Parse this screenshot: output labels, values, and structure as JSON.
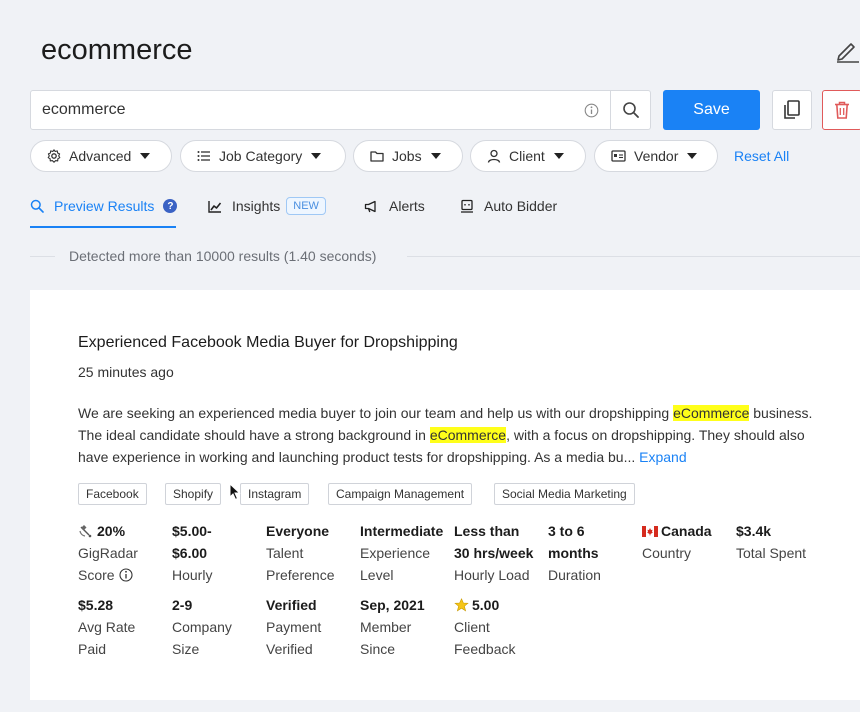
{
  "header": {
    "title": "ecommerce"
  },
  "search": {
    "value": "ecommerce",
    "save_label": "Save"
  },
  "filters": [
    {
      "label": "Advanced",
      "icon": "gear-icon"
    },
    {
      "label": "Job Category",
      "icon": "list-icon"
    },
    {
      "label": "Jobs",
      "icon": "folder-icon"
    },
    {
      "label": "Client",
      "icon": "user-icon"
    },
    {
      "label": "Vendor",
      "icon": "id-card-icon"
    }
  ],
  "reset_label": "Reset All",
  "tabs": [
    {
      "label": "Preview Results",
      "icon": "search-icon",
      "active": true
    },
    {
      "label": "Insights",
      "badge": "NEW",
      "icon": "chart-icon"
    },
    {
      "label": "Alerts",
      "icon": "megaphone-icon"
    },
    {
      "label": "Auto Bidder",
      "icon": "bot-icon"
    }
  ],
  "results_info": "Detected more than 10000 results (1.40 seconds)",
  "job": {
    "title": "Experienced Facebook Media Buyer for Dropshipping",
    "posted": "25 minutes ago",
    "desc_1": "We are seeking an experienced media buyer to join our team and help us with our dropshipping ",
    "highlight_1": "eCommerce",
    "desc_2": " business. The ideal candidate should have a strong background in ",
    "highlight_2": "eCommerce",
    "desc_3": ", with a focus on dropshipping. They should also have experience in working and launching product tests for dropshipping. As a media bu...",
    "expand_label": " Expand",
    "tags": [
      "Facebook",
      "Shopify",
      "Instagram",
      "Campaign Management",
      "Social Media Marketing"
    ],
    "stats_row1": [
      {
        "value": "20%",
        "icon": "radar-icon",
        "lines": [
          "GigRadar",
          "Score"
        ]
      },
      {
        "value": "$5.00-",
        "value2": "$6.00",
        "lines": [
          "Hourly"
        ]
      },
      {
        "value": "Everyone",
        "lines": [
          "Talent",
          "Preference"
        ]
      },
      {
        "value": "Intermediate",
        "lines": [
          "Experience",
          "Level"
        ]
      },
      {
        "value": "Less than",
        "value2": "30 hrs/week",
        "lines": [
          "Hourly Load"
        ]
      },
      {
        "value": "3 to 6",
        "value2": "months",
        "lines": [
          "Duration"
        ]
      },
      {
        "value": "Canada",
        "icon": "canada-flag-icon",
        "lines": [
          "Country"
        ]
      },
      {
        "value": "$3.4k",
        "lines": [
          "Total Spent"
        ]
      }
    ],
    "stats_row2": [
      {
        "value": "$5.28",
        "lines": [
          "Avg Rate",
          "Paid"
        ]
      },
      {
        "value": "2-9",
        "lines": [
          "Company",
          "Size"
        ]
      },
      {
        "value": "Verified",
        "lines": [
          "Payment",
          "Verified"
        ]
      },
      {
        "value": "Sep, 2021",
        "lines": [
          "Member",
          "Since"
        ]
      },
      {
        "value": "5.00",
        "icon": "star-icon",
        "lines": [
          "Client",
          "Feedback"
        ]
      }
    ]
  },
  "colors": {
    "accent": "#1a82f5",
    "danger": "#e05a5a",
    "highlight": "#ffff1a"
  }
}
